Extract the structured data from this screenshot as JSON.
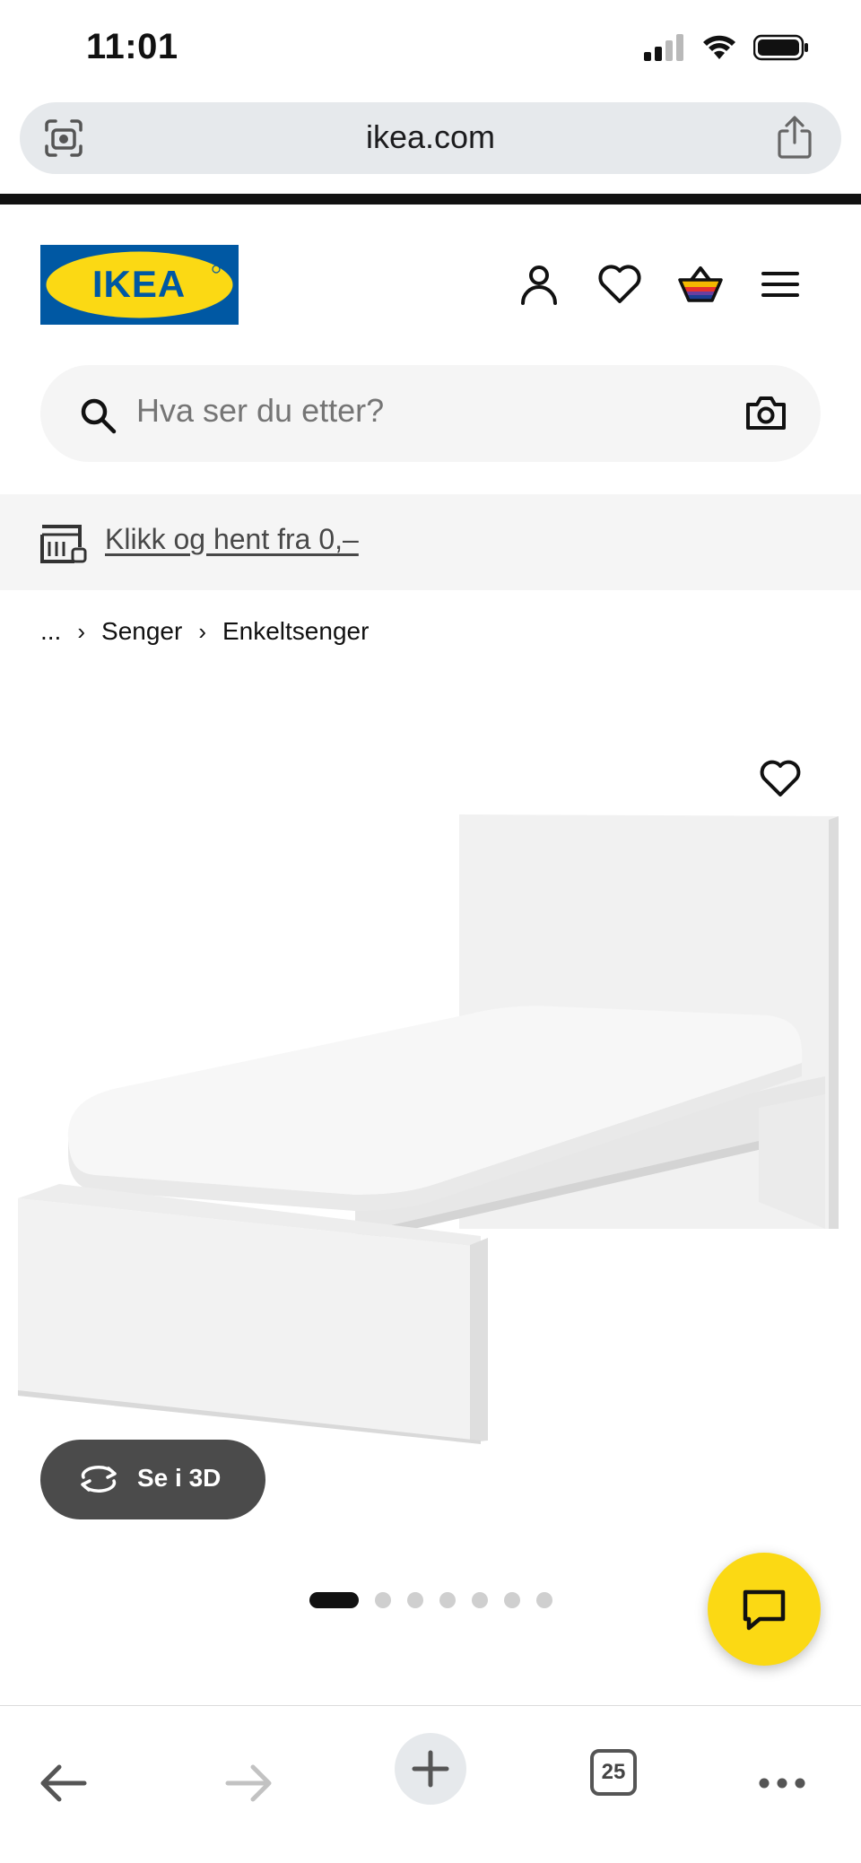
{
  "status_bar": {
    "time": "11:01"
  },
  "browser": {
    "url": "ikea.com",
    "tab_count": "25"
  },
  "header": {
    "logo_text": "IKEA"
  },
  "search": {
    "placeholder": "Hva ser du etter?"
  },
  "promo": {
    "text": "Klikk og hent fra 0,–"
  },
  "breadcrumb": {
    "ellipsis": "...",
    "items": [
      "Senger",
      "Enkeltsenger"
    ]
  },
  "product": {
    "view_3d_label": "Se i 3D",
    "image_count": 7,
    "active_image": 1
  },
  "colors": {
    "brand_blue": "#0058a3",
    "brand_yellow": "#fbd914",
    "button_dark": "#4b4b4b",
    "banner_bg": "#f5f5f5"
  },
  "icons": [
    "camera-lens-icon",
    "share-icon",
    "account-icon",
    "heart-icon",
    "basket-icon",
    "menu-icon",
    "search-icon",
    "camera-icon",
    "store-icon",
    "rotate-3d-icon",
    "chat-icon",
    "back-arrow-icon",
    "forward-arrow-icon",
    "plus-icon",
    "tabs-icon",
    "more-icon"
  ]
}
